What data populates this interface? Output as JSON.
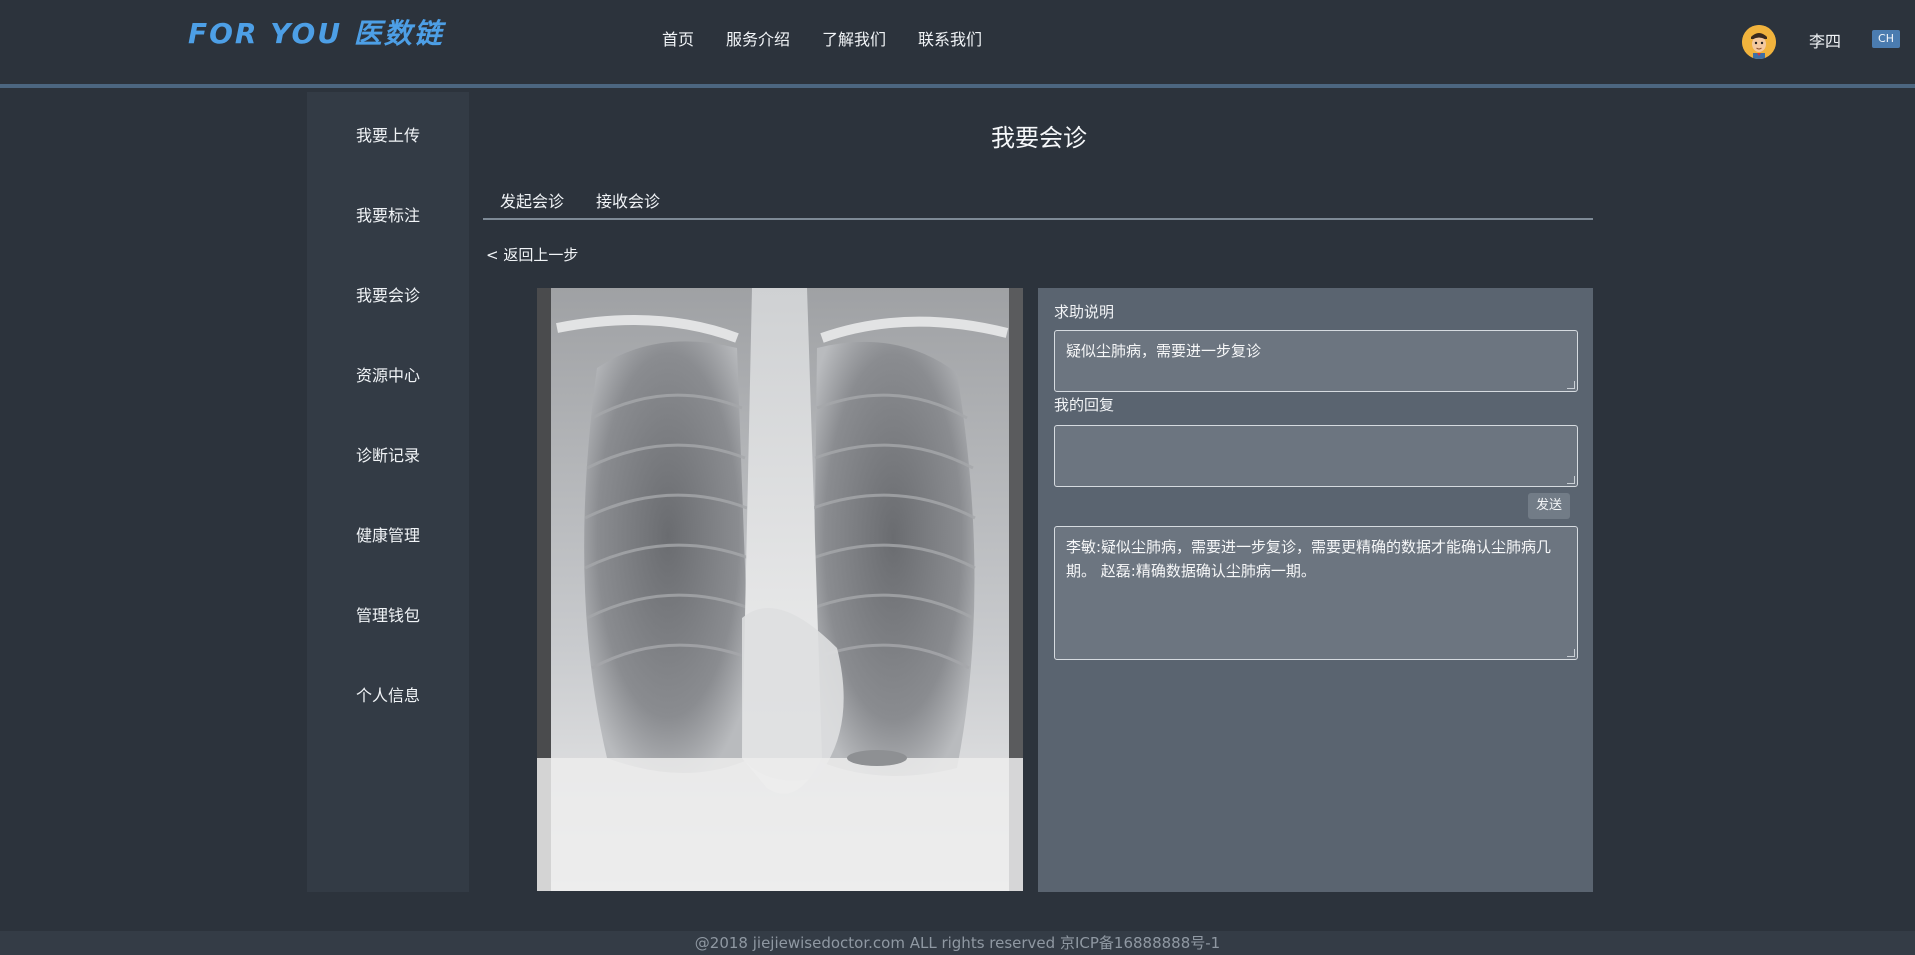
{
  "header": {
    "logo": "FOR YOU 医数链",
    "nav": [
      "首页",
      "服务介绍",
      "了解我们",
      "联系我们"
    ],
    "user_name": "李四",
    "lang": "CH"
  },
  "sidebar": {
    "items": [
      "我要上传",
      "我要标注",
      "我要会诊",
      "资源中心",
      "诊断记录",
      "健康管理",
      "管理钱包",
      "个人信息"
    ]
  },
  "main": {
    "title": "我要会诊",
    "tabs": [
      "发起会诊",
      "接收会诊"
    ],
    "back": "<  返回上一步"
  },
  "panel": {
    "help_label": "求助说明",
    "help_text": "疑似尘肺病，需要进一步复诊",
    "reply_label": "我的回复",
    "reply_value": "",
    "send_label": "发送",
    "history_text": "李敏:疑似尘肺病，需要进一步复诊，需要更精确的数据才能确认尘肺病几期。 赵磊:精确数据确认尘肺病一期。"
  },
  "footer": {
    "text": "@2018 jiejiewisedoctor.com     ALL rights reserved     京ICP备16888888号-1"
  },
  "colors": {
    "background": "#2c333c",
    "header_border": "#4c6680",
    "logo": "#4d9fe6",
    "panel": "#5a6470",
    "lang_badge": "#4b7cb0"
  }
}
